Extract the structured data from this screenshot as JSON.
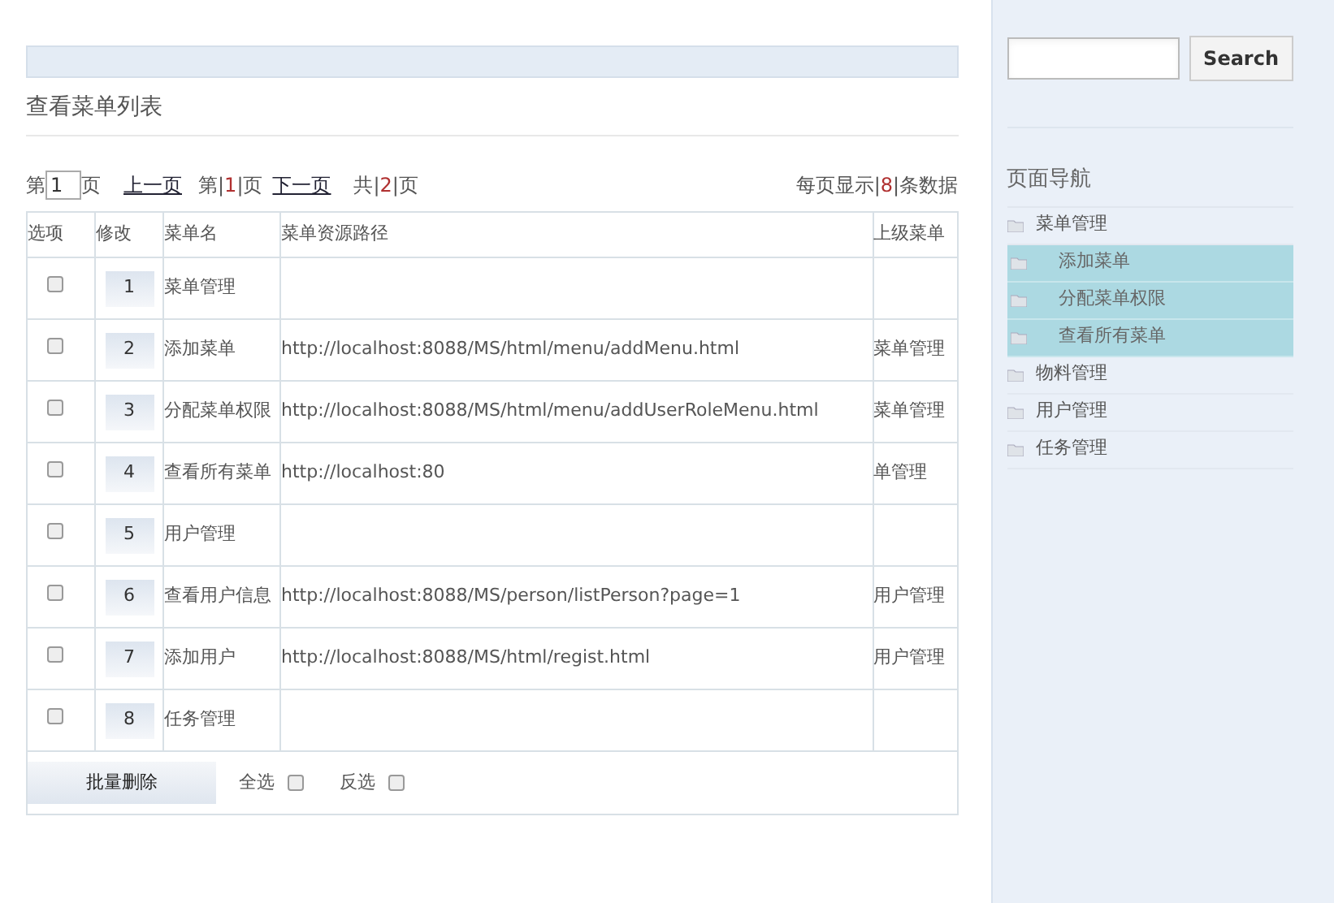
{
  "title": "查看菜单列表",
  "pagination": {
    "prefix": "第",
    "page_input": "1",
    "page_suffix": "页",
    "prev": "上一页",
    "current": {
      "before": "第|",
      "number": "1",
      "after": "|页"
    },
    "next": "下一页",
    "total": {
      "before": "共|",
      "number": "2",
      "after": "|页"
    },
    "per_page": {
      "before": "每页显示|",
      "number": "8",
      "after": "|条数据"
    }
  },
  "table": {
    "columns": [
      "选项",
      "修改",
      "菜单名",
      "菜单资源路径",
      "上级菜单"
    ],
    "rows": [
      {
        "checked": false,
        "edit": "1",
        "name": "菜单管理",
        "path": "",
        "parent": ""
      },
      {
        "checked": false,
        "edit": "2",
        "name": "添加菜单",
        "path": "http://localhost:8088/MS/html/menu/addMenu.html",
        "parent": "菜单管理"
      },
      {
        "checked": false,
        "edit": "3",
        "name": "分配菜单权限",
        "path": "http://localhost:8088/MS/html/menu/addUserRoleMenu.html",
        "parent": "菜单管理"
      },
      {
        "checked": false,
        "edit": "4",
        "name": "查看所有菜单",
        "path": "http://localhost:80",
        "parent": "单管理"
      },
      {
        "checked": false,
        "edit": "5",
        "name": "用户管理",
        "path": "",
        "parent": ""
      },
      {
        "checked": false,
        "edit": "6",
        "name": "查看用户信息",
        "path": "http://localhost:8088/MS/person/listPerson?page=1",
        "parent": "用户管理"
      },
      {
        "checked": false,
        "edit": "7",
        "name": "添加用户",
        "path": "http://localhost:8088/MS/html/regist.html",
        "parent": "用户管理"
      },
      {
        "checked": false,
        "edit": "8",
        "name": "任务管理",
        "path": "",
        "parent": ""
      }
    ]
  },
  "footer": {
    "batch_delete": "批量删除",
    "select_all": {
      "label": "全选",
      "checked": false
    },
    "invert": {
      "label": "反选",
      "checked": false
    }
  },
  "sidebar": {
    "search": {
      "button": "Search"
    },
    "nav_title": "页面导航",
    "items": [
      {
        "label": "菜单管理",
        "children": [
          {
            "label": "添加菜单"
          },
          {
            "label": "分配菜单权限"
          },
          {
            "label": "查看所有菜单"
          }
        ]
      },
      {
        "label": "物料管理"
      },
      {
        "label": "用户管理"
      },
      {
        "label": "任务管理"
      }
    ]
  }
}
